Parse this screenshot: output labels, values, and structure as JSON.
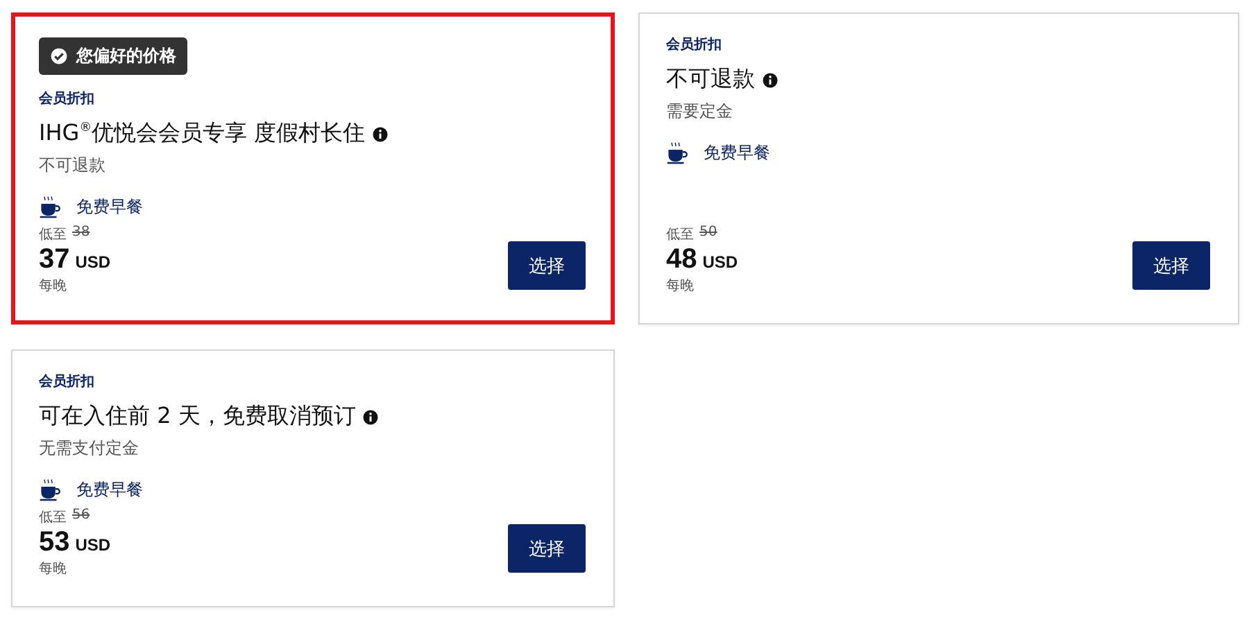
{
  "rates": [
    {
      "selected": true,
      "badge": "您偏好的价格",
      "category": "会员折扣",
      "title": "IHG$^{®}$优悦会会员专享 度假村长住",
      "policy": "不可退款",
      "perk": "免费早餐",
      "from_label": "低至",
      "was_price": "38",
      "price": "37",
      "currency": "USD",
      "per": "每晚",
      "button": "选择"
    },
    {
      "selected": false,
      "category": "会员折扣",
      "title": "不可退款",
      "policy": "需要定金",
      "perk": "免费早餐",
      "from_label": "低至",
      "was_price": "50",
      "price": "48",
      "currency": "USD",
      "per": "每晚",
      "button": "选择"
    },
    {
      "selected": false,
      "category": "会员折扣",
      "title": "可在入住前 2 天，免费取消预订",
      "policy": "无需支付定金",
      "perk": "免费早餐",
      "from_label": "低至",
      "was_price": "56",
      "price": "53",
      "currency": "USD",
      "per": "每晚",
      "button": "选择"
    }
  ]
}
